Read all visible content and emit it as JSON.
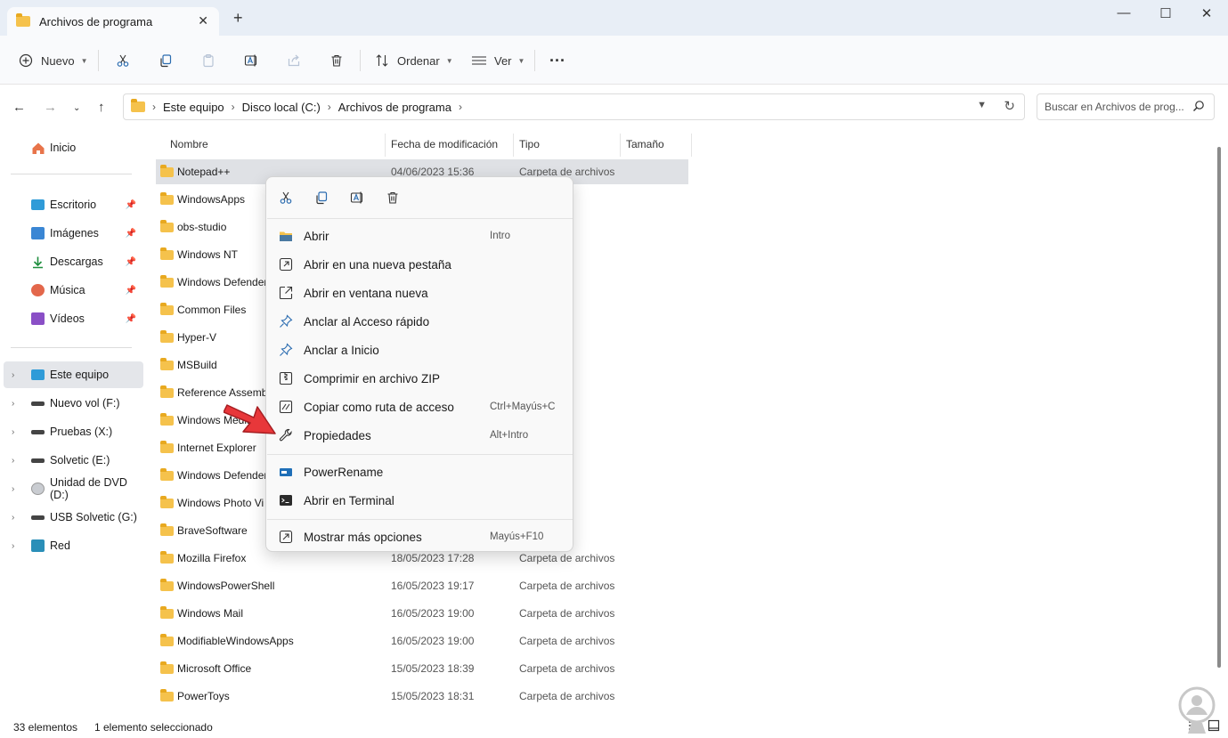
{
  "window": {
    "tab_title": "Archivos de programa",
    "tab_close": "✕",
    "new_tab": "+",
    "minimize": "—",
    "maximize": "☐",
    "close": "✕"
  },
  "toolbar": {
    "new_label": "Nuevo",
    "sort_label": "Ordenar",
    "view_label": "Ver",
    "more_label": "···"
  },
  "breadcrumb": [
    "Este equipo",
    "Disco local (C:)",
    "Archivos de programa"
  ],
  "search": {
    "placeholder": "Buscar en Archivos de prog..."
  },
  "sidebar": {
    "home": "Inicio",
    "quick": [
      {
        "label": "Escritorio",
        "icon": "desktop-icon",
        "color": "#2f9bd8"
      },
      {
        "label": "Imágenes",
        "icon": "pictures-icon",
        "color": "#3a86d4"
      },
      {
        "label": "Descargas",
        "icon": "downloads-icon",
        "color": "#1e8e3e"
      },
      {
        "label": "Música",
        "icon": "music-icon",
        "color": "#e3674b"
      },
      {
        "label": "Vídeos",
        "icon": "videos-icon",
        "color": "#8a4fc6"
      }
    ],
    "drives": [
      {
        "label": "Este equipo",
        "icon": "this-pc-icon"
      },
      {
        "label": "Nuevo vol (F:)",
        "icon": "drive-icon"
      },
      {
        "label": "Pruebas (X:)",
        "icon": "drive-icon"
      },
      {
        "label": "Solvetic (E:)",
        "icon": "drive-icon"
      },
      {
        "label": "Unidad de DVD (D:)",
        "icon": "dvd-icon"
      },
      {
        "label": "USB Solvetic (G:)",
        "icon": "drive-icon"
      },
      {
        "label": "Red",
        "icon": "network-icon"
      }
    ]
  },
  "columns": [
    "Nombre",
    "Fecha de modificación",
    "Tipo",
    "Tamaño"
  ],
  "files": [
    {
      "name": "Notepad++",
      "date": "04/06/2023 15:36",
      "type": "Carpeta de archivos"
    },
    {
      "name": "WindowsApps",
      "date": "",
      "type": "archivos"
    },
    {
      "name": "obs-studio",
      "date": "",
      "type": "archivos"
    },
    {
      "name": "Windows NT",
      "date": "",
      "type": "archivos"
    },
    {
      "name": "Windows Defender",
      "date": "",
      "type": "archivos"
    },
    {
      "name": "Common Files",
      "date": "",
      "type": "archivos"
    },
    {
      "name": "Hyper-V",
      "date": "",
      "type": "archivos"
    },
    {
      "name": "MSBuild",
      "date": "",
      "type": "archivos"
    },
    {
      "name": "Reference Assemb",
      "date": "",
      "type": "archivos"
    },
    {
      "name": "Windows Media Pl",
      "date": "",
      "type": "archivos"
    },
    {
      "name": "Internet Explorer",
      "date": "",
      "type": "archivos"
    },
    {
      "name": "Windows Defender",
      "date": "",
      "type": "archivos"
    },
    {
      "name": "Windows Photo Vi",
      "date": "",
      "type": "archivos"
    },
    {
      "name": "BraveSoftware",
      "date": "",
      "type": "archivos"
    },
    {
      "name": "Mozilla Firefox",
      "date": "18/05/2023 17:28",
      "type": "Carpeta de archivos"
    },
    {
      "name": "WindowsPowerShell",
      "date": "16/05/2023 19:17",
      "type": "Carpeta de archivos"
    },
    {
      "name": "Windows Mail",
      "date": "16/05/2023 19:00",
      "type": "Carpeta de archivos"
    },
    {
      "name": "ModifiableWindowsApps",
      "date": "16/05/2023 19:00",
      "type": "Carpeta de archivos"
    },
    {
      "name": "Microsoft Office",
      "date": "15/05/2023 18:39",
      "type": "Carpeta de archivos"
    },
    {
      "name": "PowerToys",
      "date": "15/05/2023 18:31",
      "type": "Carpeta de archivos"
    }
  ],
  "status": {
    "count": "33 elementos",
    "selected": "1 elemento seleccionado"
  },
  "context_menu": {
    "items": [
      {
        "label": "Abrir",
        "shortcut": "Intro",
        "icon": "folder-open-icon"
      },
      {
        "label": "Abrir en una nueva pestaña",
        "shortcut": "",
        "icon": "new-tab-icon"
      },
      {
        "label": "Abrir en ventana nueva",
        "shortcut": "",
        "icon": "new-window-icon"
      },
      {
        "label": "Anclar al Acceso rápido",
        "shortcut": "",
        "icon": "pin-icon"
      },
      {
        "label": "Anclar a Inicio",
        "shortcut": "",
        "icon": "pin-start-icon"
      },
      {
        "label": "Comprimir en archivo ZIP",
        "shortcut": "",
        "icon": "zip-icon"
      },
      {
        "label": "Copiar como ruta de acceso",
        "shortcut": "Ctrl+Mayús+C",
        "icon": "copy-path-icon"
      },
      {
        "label": "Propiedades",
        "shortcut": "Alt+Intro",
        "icon": "wrench-icon"
      }
    ],
    "extra": [
      {
        "label": "PowerRename",
        "icon": "power-rename-icon"
      },
      {
        "label": "Abrir en Terminal",
        "icon": "terminal-icon"
      }
    ],
    "more": {
      "label": "Mostrar más opciones",
      "shortcut": "Mayús+F10",
      "icon": "more-options-icon"
    }
  },
  "colors": {
    "accent": "#0067c0",
    "folder": "#f5c24c",
    "arrow": "#e8373a",
    "selection": "#dfe1e5"
  }
}
